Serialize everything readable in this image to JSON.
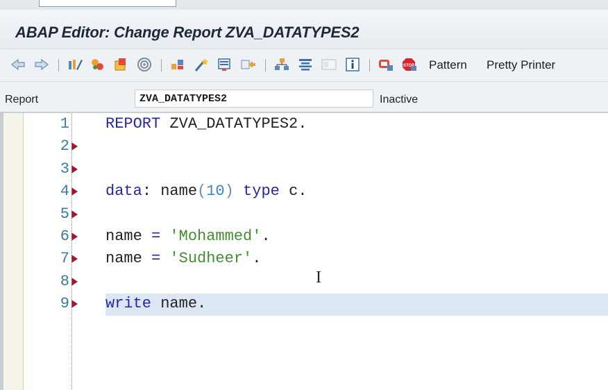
{
  "window": {
    "title": "ABAP Editor: Change Report ZVA_DATATYPES2"
  },
  "toolbar": {
    "icons": [
      "back-icon",
      "forward-icon",
      "toggle-display-change-icon",
      "other-object-icon",
      "activate-icon",
      "check-icon",
      "test-icon",
      "where-used-icon",
      "display-object-list-icon",
      "help-icon",
      "navigation-window-icon",
      "breakpoint-icon",
      "stop-icon",
      "information-icon",
      "layout-icon",
      "mode-icon"
    ],
    "pattern_label": "Pattern",
    "pretty_printer_label": "Pretty Printer"
  },
  "report_row": {
    "label": "Report",
    "value": "ZVA_DATATYPES2",
    "status": "Inactive"
  },
  "editor": {
    "lines": [
      {
        "number": "1",
        "tokens": [
          [
            "kw",
            "REPORT"
          ],
          [
            "pt",
            " "
          ],
          [
            "id",
            "ZVA_DATATYPES2"
          ],
          [
            "pt",
            "."
          ]
        ],
        "highlighted": false,
        "has_marker": false
      },
      {
        "number": "2",
        "tokens": [],
        "highlighted": false,
        "has_marker": true
      },
      {
        "number": "3",
        "tokens": [],
        "highlighted": false,
        "has_marker": true
      },
      {
        "number": "4",
        "tokens": [
          [
            "kw",
            "data"
          ],
          [
            "pt",
            ": "
          ],
          [
            "id",
            "name"
          ],
          [
            "paren",
            "("
          ],
          [
            "num",
            "10"
          ],
          [
            "paren",
            ")"
          ],
          [
            "pt",
            " "
          ],
          [
            "kw",
            "type"
          ],
          [
            "pt",
            " "
          ],
          [
            "id",
            "c"
          ],
          [
            "pt",
            "."
          ]
        ],
        "highlighted": false,
        "has_marker": true
      },
      {
        "number": "5",
        "tokens": [],
        "highlighted": false,
        "has_marker": true
      },
      {
        "number": "6",
        "tokens": [
          [
            "id",
            "name"
          ],
          [
            "pt",
            " "
          ],
          [
            "kw",
            "="
          ],
          [
            "pt",
            " "
          ],
          [
            "str",
            "'Mohammed'"
          ],
          [
            "pt",
            "."
          ]
        ],
        "highlighted": false,
        "has_marker": true
      },
      {
        "number": "7",
        "tokens": [
          [
            "id",
            "name"
          ],
          [
            "pt",
            " "
          ],
          [
            "kw",
            "="
          ],
          [
            "pt",
            " "
          ],
          [
            "str",
            "'Sudheer'"
          ],
          [
            "pt",
            "."
          ]
        ],
        "highlighted": false,
        "has_marker": true
      },
      {
        "number": "8",
        "tokens": [],
        "highlighted": false,
        "has_marker": true
      },
      {
        "number": "9",
        "tokens": [
          [
            "kw",
            "write"
          ],
          [
            "pt",
            " "
          ],
          [
            "id",
            "name"
          ],
          [
            "pt",
            "."
          ]
        ],
        "highlighted": true,
        "has_marker": true
      }
    ]
  },
  "colors": {
    "keyword": "#2626a8",
    "number": "#3b86c6",
    "string": "#3f8f2f",
    "line_number": "#3a7f96",
    "marker": "#a4172f",
    "current_line": "#dde7f4"
  }
}
